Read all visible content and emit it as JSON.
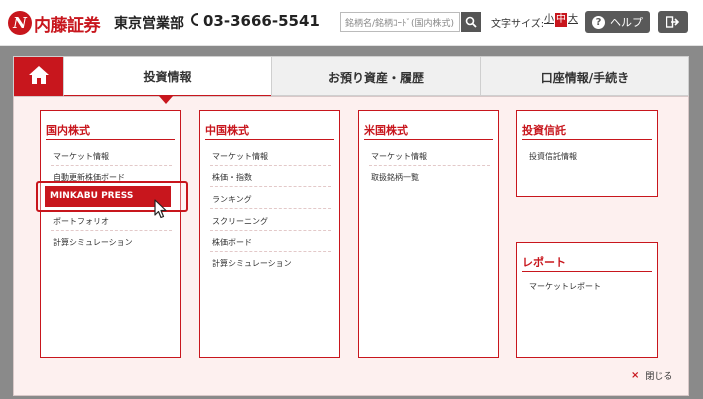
{
  "header": {
    "logo_mark": "N",
    "logo_text": "内藤証券",
    "branch": "東京営業部",
    "phone": "03-3666-5541",
    "search_placeholder": "銘柄名/銘柄ｺｰﾄﾞ(国内株式)",
    "font_size_label": "文字サイズ:",
    "font_small": "小",
    "font_mid": "中",
    "font_large": "大",
    "help_label": "ヘルプ",
    "help_icon_glyph": "?"
  },
  "nav": {
    "tabs": [
      {
        "label": "投資情報"
      },
      {
        "label": "お預り資産・履歴"
      },
      {
        "label": "口座情報/手続き"
      }
    ]
  },
  "menu": {
    "domestic": {
      "title": "国内株式",
      "items": [
        "マーケット情報",
        "自動更新株価ボード",
        "MINKABU PRESS",
        "ポートフォリオ",
        "計算シミュレーション"
      ]
    },
    "china": {
      "title": "中国株式",
      "items": [
        "マーケット情報",
        "株価・指数",
        "ランキング",
        "スクリーニング",
        "株価ボード",
        "計算シミュレーション"
      ]
    },
    "us": {
      "title": "米国株式",
      "items": [
        "マーケット情報",
        "取扱銘柄一覧"
      ]
    },
    "fund": {
      "title": "投資信託",
      "items": [
        "投資信託情報"
      ]
    },
    "report": {
      "title": "レポート",
      "items": [
        "マーケットレポート"
      ]
    },
    "close_label": "閉じる",
    "close_glyph": "×"
  },
  "colors": {
    "brand": "#c8161d",
    "panel_bg": "#fdf0ef",
    "button_bg": "#595959"
  },
  "icons": [
    "home-icon",
    "phone-icon",
    "search-icon",
    "help-icon",
    "logout-icon",
    "cursor-icon",
    "close-icon"
  ]
}
